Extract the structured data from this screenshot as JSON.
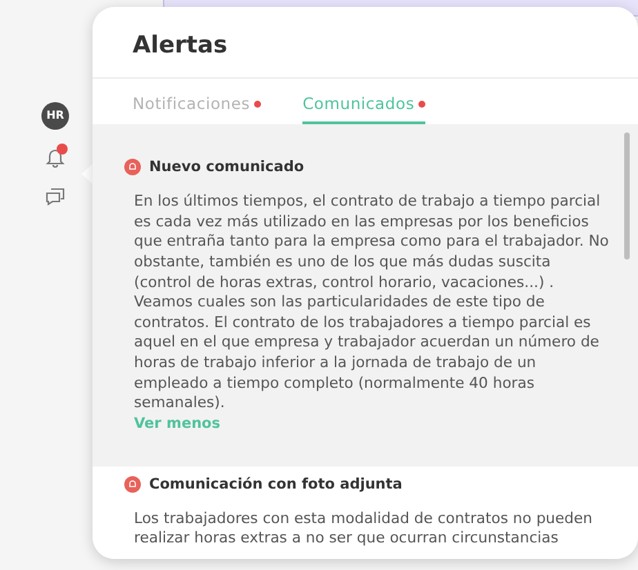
{
  "sidebar": {
    "avatar": "HR",
    "items": [
      {
        "kind": "bell",
        "badge": true
      },
      {
        "kind": "chat"
      }
    ]
  },
  "panel": {
    "title": "Alertas",
    "tabs": [
      {
        "label": "Notificaciones",
        "selected": false,
        "dot": true
      },
      {
        "label": "Comunicados",
        "selected": true,
        "dot": true
      }
    ],
    "items": [
      {
        "title": "Nuevo comunicado",
        "expanded": true,
        "body": "En los últimos tiempos, el contrato de trabajo a tiempo parcial es cada vez más utilizado en las empresas por los beneficios que entraña tanto para la empresa como para el trabajador. No obstante, también es uno de los que más dudas suscita (control de horas extras, control horario, vacaciones...) . Veamos cuales son las particularidades de este tipo de contratos. El contrato de los trabajadores a tiempo parcial es aquel en el que empresa y trabajador acuerdan un número de horas de trabajo inferior a la jornada de trabajo de un empleado a tiempo completo (normalmente 40 horas semanales).",
        "toggle": "Ver menos"
      },
      {
        "title": "Comunicación con foto adjunta",
        "expanded": false,
        "body": "Los trabajadores con esta modalidad de contratos no pueden realizar horas extras a no ser que ocurran circunstancias"
      }
    ]
  }
}
